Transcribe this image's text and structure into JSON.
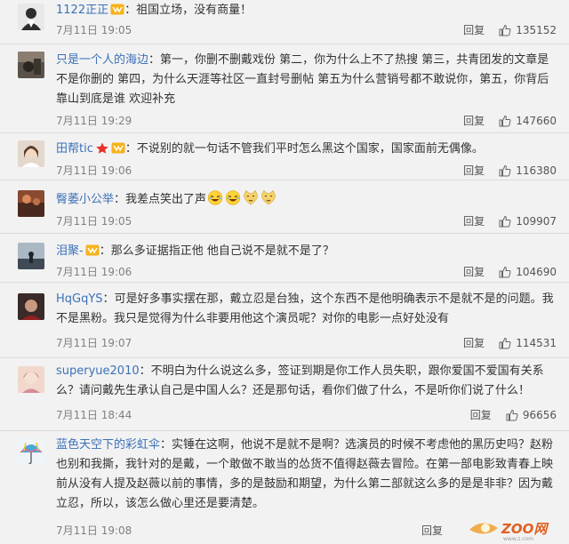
{
  "comments": [
    {
      "username": "1122正正",
      "separator": "：",
      "text": "祖国立场，没有商量！",
      "time": "7月11日 19:05",
      "reply_label": "回复",
      "likes": "135152",
      "avatar_color": "#2c2c2c"
    },
    {
      "username": "只是一个人的海边",
      "separator": "：",
      "text": "第一，你删不删戴戏份 第二，你为什么上不了热搜 第三，共青团发的文章是不是你删的  第四，为什么天涯等社区一直封号删帖 第五为什么营销号都不敢说你，第五，你背后靠山到底是谁 欢迎补充",
      "time": "7月11日 19:29",
      "reply_label": "回复",
      "likes": "147660",
      "avatar_color": "#3a3530"
    },
    {
      "username": "田帮tic",
      "separator": "：",
      "text": "不说别的就一句话不管我们平时怎么黑这个国家，国家面前无偶像。",
      "time": "7月11日 19:06",
      "reply_label": "回复",
      "likes": "116380",
      "avatar_color": "#c9b7a3"
    },
    {
      "username": "臀萎小公举",
      "separator": "：",
      "text": "我差点笑出了声",
      "time": "7月11日 19:05",
      "reply_label": "回复",
      "likes": "109907",
      "avatar_color": "#6b3a2a"
    },
    {
      "username": "泪聚-",
      "separator": "：",
      "text": "那么多证据指正他 他自己说不是就不是了？",
      "time": "7月11日 19:06",
      "reply_label": "回复",
      "likes": "104690",
      "avatar_color": "#5a6a78"
    },
    {
      "username": "HqGqYS",
      "separator": "：",
      "text": "可是好多事实摆在那，戴立忍是台独，这个东西不是他明确表示不是就不是的问题。我不是黑粉。我只是觉得为什么非要用他这个演员呢？对你的电影一点好处没有",
      "time": "7月11日 19:07",
      "reply_label": "回复",
      "likes": "114531",
      "avatar_color": "#7a3a3a"
    },
    {
      "username": "superyue2010",
      "separator": "：",
      "text": "不明白为什么说这么多，签证到期是你工作人员失职，跟你爱国不爱国有关系么？请问戴先生承认自己是中国人么？还是那句话，看你们做了什么，不是听你们说了什么！",
      "time": "7月11日 18:44",
      "reply_label": "回复",
      "likes": "96656",
      "avatar_color": "#d9a89a"
    },
    {
      "username": "蓝色天空下的彩虹伞",
      "separator": "：",
      "text": "实锤在这啊，他说不是就不是啊？选演员的时候不考虑他的黑历史吗？赵粉也别和我撕，我针对的是戴，一个敢做不敢当的怂货不值得赵薇去冒险。在第一部电影致青春上映前从没有人提及赵薇以前的事情，多的是鼓励和期望，为什么第二部就这么多的是是非非？因为戴立忍，所以，该怎么做心里还是要清楚。",
      "time": "7月11日 19:08",
      "reply_label": "回复",
      "likes": "",
      "avatar_color": "#4aa8d8"
    }
  ],
  "colors": {
    "username": "#3b71b8",
    "text": "#333333",
    "time": "#808080",
    "background": "#f2f2f2"
  },
  "icons": {
    "like": "thumbs-up-icon",
    "badge": "vip-badge-icon",
    "emoji_laugh": "laughing-emoji-icon",
    "emoji_cat": "cat-emoji-icon"
  }
}
